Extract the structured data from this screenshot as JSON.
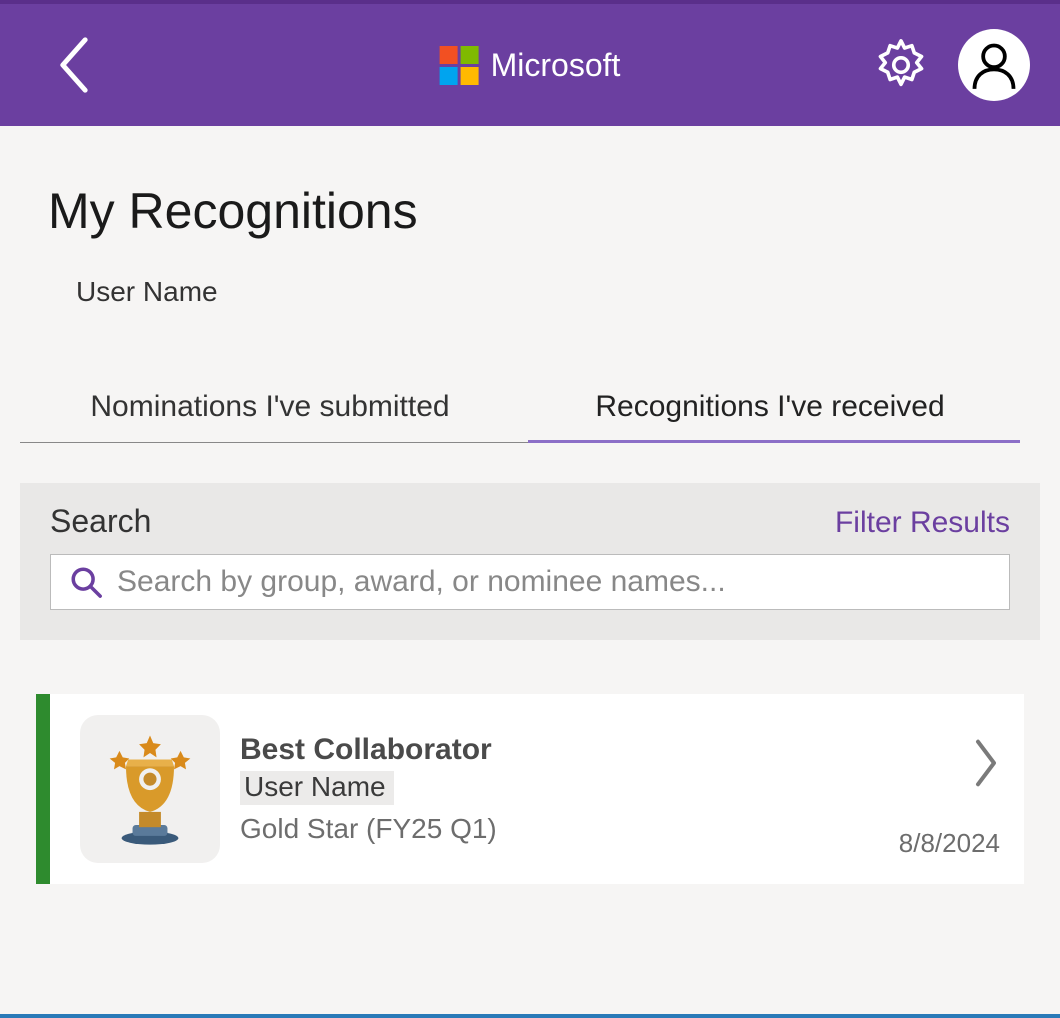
{
  "header": {
    "brand_label": "Microsoft"
  },
  "page": {
    "title": "My Recognitions",
    "user_label": "User Name"
  },
  "tabs": {
    "submitted": "Nominations I've submitted",
    "received": "Recognitions I've received"
  },
  "search": {
    "label": "Search",
    "filter_label": "Filter Results",
    "placeholder": "Search by group, award, or nominee names..."
  },
  "recognitions": [
    {
      "title": "Best Collaborator",
      "user": "User Name",
      "award_group": "Gold Star (FY25 Q1)",
      "date": "8/8/2024"
    }
  ]
}
